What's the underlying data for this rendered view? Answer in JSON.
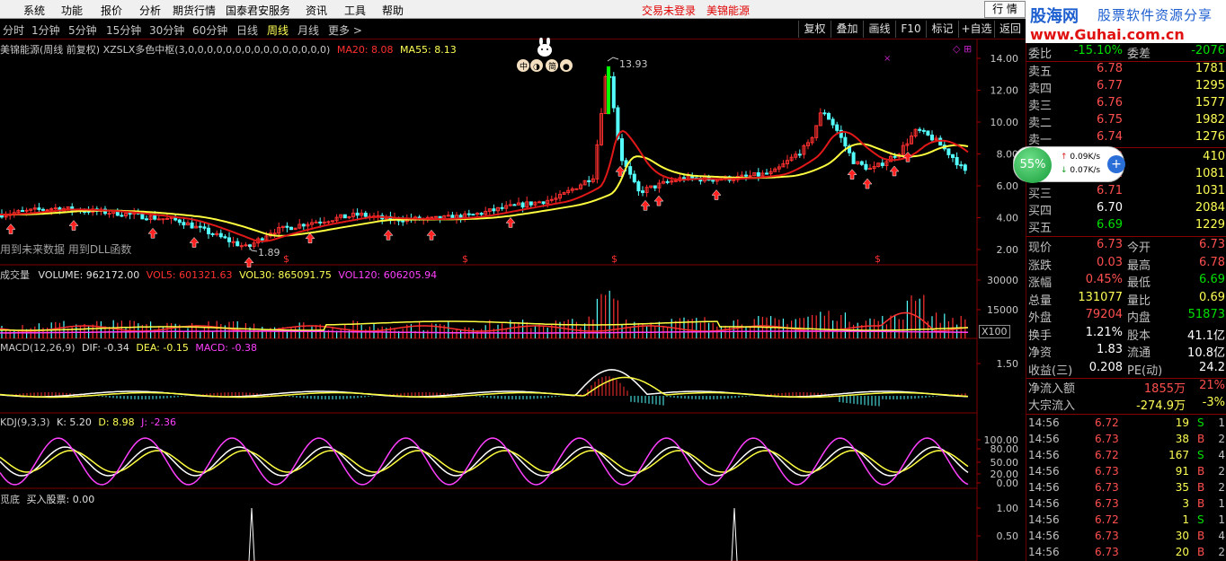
{
  "menu": {
    "items": [
      "系统",
      "功能",
      "报价",
      "分析",
      "期货行情",
      "国泰君安服务",
      "资讯",
      "工具",
      "帮助"
    ],
    "status": "交易未登录",
    "stock_name": "美锦能源",
    "quote_button": "行 情"
  },
  "watermark": {
    "logo": "股海网",
    "slogan": "股票软件资源分享",
    "url": "www.Guhai.com.cn"
  },
  "toolbar": {
    "periods": [
      "分时",
      "1分钟",
      "5分钟",
      "15分钟",
      "30分钟",
      "60分钟",
      "日线",
      "周线",
      "月线",
      "更多 >"
    ],
    "active_period": "周线",
    "buttons": [
      "复权",
      "叠加",
      "画线",
      "F10",
      "标记",
      "+自选",
      "返回"
    ]
  },
  "main_chart": {
    "title": "美锦能源(周线 前复权)",
    "indicator": "XZSLX多色中枢(3,0,0,0,0,0,0,0,0,0,0,0,0,0,0,0)",
    "ma20_label": "MA20: 8.08",
    "ma55_label": "MA55: 8.13",
    "note": "用到未来数据 用到DLL函数",
    "high_label": "13.93",
    "low_label": "1.89",
    "y_ticks": [
      "14.00",
      "12.00",
      "10.00",
      "8.00",
      "6.00",
      "4.00",
      "2.00"
    ],
    "colors": {
      "ma20": "#e01818",
      "ma55": "#ffff40",
      "up": "#ff3030",
      "down": "#54ffff",
      "arrow": "#ff2020"
    }
  },
  "volume_chart": {
    "title": "成交量",
    "volume": "VOLUME: 962172.00",
    "vol5": "VOL5: 601321.63",
    "vol30": "VOL30: 865091.75",
    "vol120": "VOL120: 606205.94",
    "y_ticks": [
      "30000",
      "15000"
    ],
    "unit": "X100"
  },
  "macd_chart": {
    "title": "MACD(12,26,9)",
    "dif": "DIF: -0.34",
    "dea": "DEA: -0.15",
    "macd": "MACD: -0.38",
    "y_ticks": [
      "1.50"
    ]
  },
  "kdj_chart": {
    "title": "KDJ(9,3,3)",
    "k": "K: 5.20",
    "d": "D: 8.98",
    "j": "J: -2.36",
    "y_ticks": [
      "100.00",
      "80.00",
      "50.00",
      "20.00",
      "0.00"
    ]
  },
  "bottom_chart": {
    "title": "觅底",
    "value": "买入股票: 0.00",
    "y_ticks": [
      "1.00",
      "0.50"
    ]
  },
  "flow_widget": {
    "percent": "55%",
    "up_rate": "0.09K/s",
    "down_rate": "0.07K/s"
  },
  "order_book": {
    "top_row": {
      "label": "委比",
      "value": "-15.10%",
      "label2": "委差",
      "value2": "-2076"
    },
    "asks": [
      {
        "label": "卖五",
        "price": "6.78",
        "vol": "1781"
      },
      {
        "label": "卖四",
        "price": "6.77",
        "vol": "1295"
      },
      {
        "label": "卖三",
        "price": "6.76",
        "vol": "1577"
      },
      {
        "label": "卖二",
        "price": "6.75",
        "vol": "1982"
      },
      {
        "label": "卖一",
        "price": "6.74",
        "vol": "1276"
      }
    ],
    "bids": [
      {
        "label": "买一",
        "price": "6.73",
        "vol": "410"
      },
      {
        "label": "买二",
        "price": "6.72",
        "vol": "1081"
      },
      {
        "label": "买三",
        "price": "6.71",
        "vol": "1031"
      },
      {
        "label": "买四",
        "price": "6.70",
        "vol": "2084"
      },
      {
        "label": "买五",
        "price": "6.69",
        "vol": "1229"
      }
    ]
  },
  "stats": [
    {
      "l1": "现价",
      "v1": "6.73",
      "c1": "red",
      "l2": "今开",
      "v2": "6.73",
      "c2": "red"
    },
    {
      "l1": "涨跌",
      "v1": "0.03",
      "c1": "red",
      "l2": "最高",
      "v2": "6.78",
      "c2": "red"
    },
    {
      "l1": "涨幅",
      "v1": "0.45%",
      "c1": "red",
      "l2": "最低",
      "v2": "6.69",
      "c2": "green"
    },
    {
      "l1": "总量",
      "v1": "131077",
      "c1": "yellow",
      "l2": "量比",
      "v2": "0.69",
      "c2": "yellow"
    },
    {
      "l1": "外盘",
      "v1": "79204",
      "c1": "red",
      "l2": "内盘",
      "v2": "51873",
      "c2": "green"
    },
    {
      "l1": "换手",
      "v1": "1.21%",
      "c1": "white",
      "l2": "股本",
      "v2": "41.1亿",
      "c2": "white"
    },
    {
      "l1": "净资",
      "v1": "1.83",
      "c1": "white",
      "l2": "流通",
      "v2": "10.8亿",
      "c2": "white"
    },
    {
      "l1": "收益(三)",
      "v1": "0.208",
      "c1": "white",
      "l2": "PE(动)",
      "v2": "24.2",
      "c2": "white"
    }
  ],
  "flows": [
    {
      "label": "净流入额",
      "value": "1855万",
      "pct": "21%",
      "color": "red"
    },
    {
      "label": "大宗流入",
      "value": "-274.9万",
      "pct": "-3%",
      "color": "yellow"
    }
  ],
  "ticks": [
    {
      "time": "14:56",
      "price": "6.72",
      "vol": "19",
      "side": "S",
      "n": "1"
    },
    {
      "time": "14:56",
      "price": "6.73",
      "vol": "38",
      "side": "B",
      "n": "2"
    },
    {
      "time": "14:56",
      "price": "6.72",
      "vol": "167",
      "side": "S",
      "n": "4"
    },
    {
      "time": "14:56",
      "price": "6.73",
      "vol": "91",
      "side": "B",
      "n": "2"
    },
    {
      "time": "14:56",
      "price": "6.73",
      "vol": "35",
      "side": "B",
      "n": "2"
    },
    {
      "time": "14:56",
      "price": "6.73",
      "vol": "3",
      "side": "B",
      "n": "1"
    },
    {
      "time": "14:56",
      "price": "6.72",
      "vol": "1",
      "side": "S",
      "n": "1"
    },
    {
      "time": "14:56",
      "price": "6.73",
      "vol": "30",
      "side": "B",
      "n": "4"
    },
    {
      "time": "14:56",
      "price": "6.73",
      "vol": "20",
      "side": "B",
      "n": "2"
    }
  ]
}
